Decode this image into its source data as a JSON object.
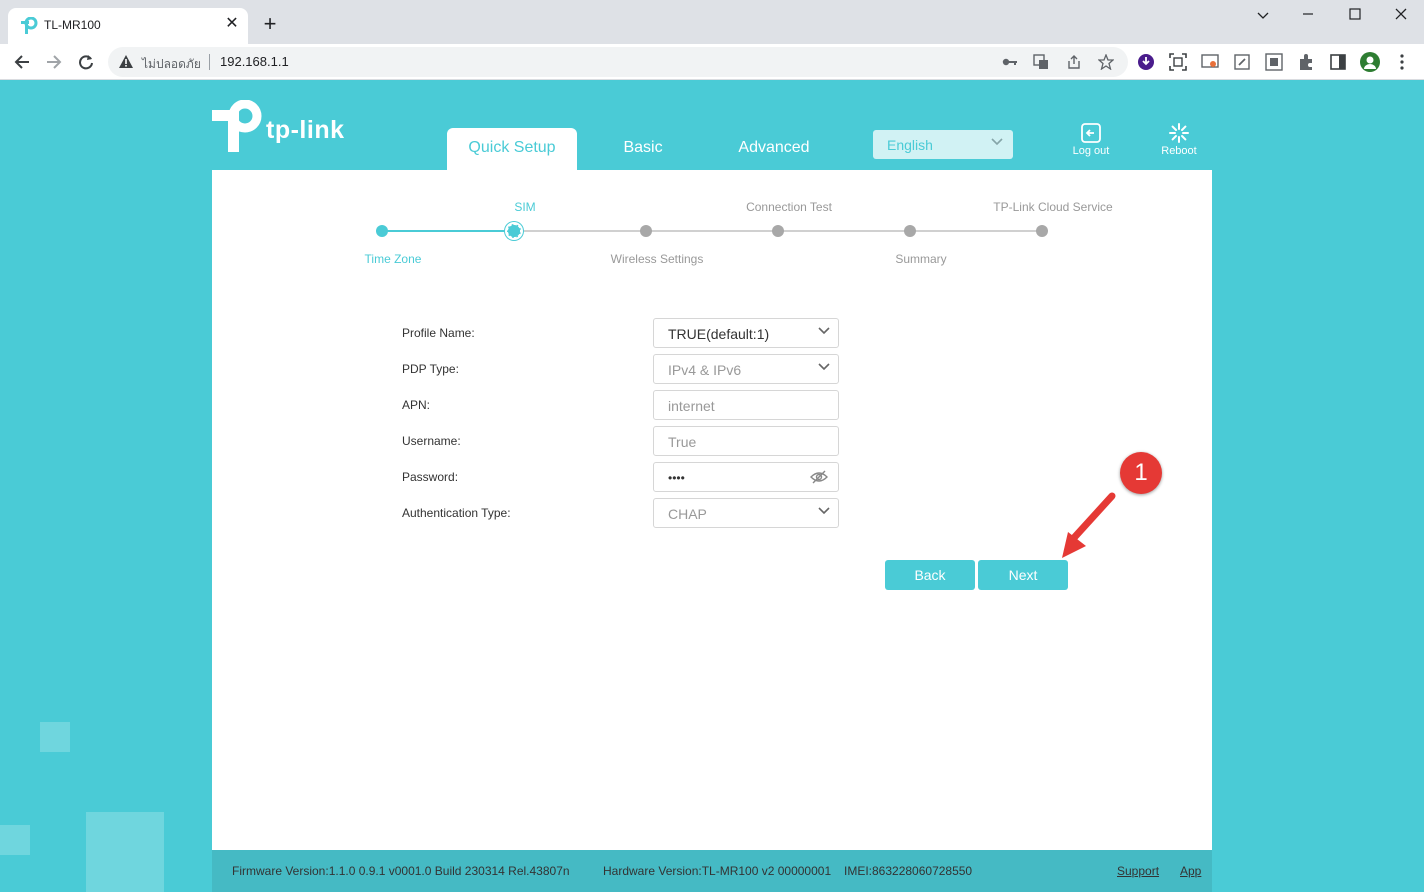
{
  "browser": {
    "tab_title": "TL-MR100",
    "security_label": "ไม่ปลอดภัย",
    "url": "192.168.1.1"
  },
  "header": {
    "logo_text": "tp-link",
    "tabs": [
      {
        "label": "Quick Setup",
        "active": true
      },
      {
        "label": "Basic",
        "active": false
      },
      {
        "label": "Advanced",
        "active": false
      }
    ],
    "language": "English",
    "logout_label": "Log out",
    "reboot_label": "Reboot"
  },
  "wizard": {
    "steps": [
      {
        "label": "Time Zone",
        "state": "done"
      },
      {
        "label": "SIM",
        "state": "current"
      },
      {
        "label": "Wireless Settings",
        "state": "pending"
      },
      {
        "label": "Connection Test",
        "state": "pending"
      },
      {
        "label": "Summary",
        "state": "pending"
      },
      {
        "label": "TP-Link Cloud Service",
        "state": "pending"
      }
    ]
  },
  "form": {
    "profile_name": {
      "label": "Profile Name:",
      "value": "TRUE(default:1)"
    },
    "pdp_type": {
      "label": "PDP Type:",
      "value": "IPv4 & IPv6"
    },
    "apn": {
      "label": "APN:",
      "value": "internet"
    },
    "username": {
      "label": "Username:",
      "value": "True"
    },
    "password": {
      "label": "Password:",
      "value": "••••"
    },
    "auth_type": {
      "label": "Authentication Type:",
      "value": "CHAP"
    }
  },
  "buttons": {
    "back": "Back",
    "next": "Next"
  },
  "annotation": {
    "marker": "1"
  },
  "footer": {
    "firmware": "Firmware Version:1.1.0 0.9.1 v0001.0 Build 230314 Rel.43807n",
    "hardware": "Hardware Version:TL-MR100 v2 00000001",
    "imei": "IMEI:863228060728550",
    "support": "Support",
    "app": "App"
  },
  "colors": {
    "accent": "#4acbd6",
    "annotation_red": "#e53935"
  }
}
